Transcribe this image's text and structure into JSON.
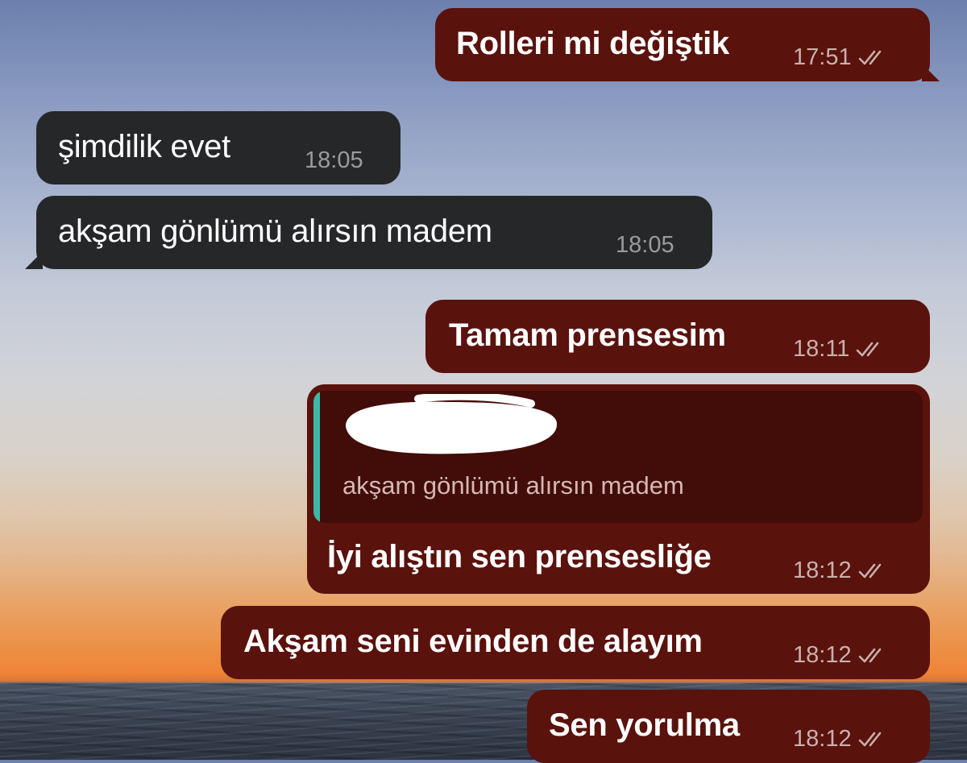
{
  "colors": {
    "outgoing_bubble": "#5a120d",
    "incoming_bubble": "#262729",
    "reply_accent": "#3cb8a8"
  },
  "messages": [
    {
      "direction": "outgoing",
      "text": "Rolleri mi değiştik",
      "time": "17:51",
      "status_icon": "double-check-icon"
    },
    {
      "direction": "incoming",
      "text": "şimdilik evet",
      "time": "18:05"
    },
    {
      "direction": "incoming",
      "text": "akşam gönlümü alırsın madem",
      "time": "18:05"
    },
    {
      "direction": "outgoing",
      "text": "Tamam prensesim",
      "time": "18:11",
      "status_icon": "double-check-icon"
    },
    {
      "direction": "outgoing",
      "text": "İyi alıştın sen prensesliğe",
      "time": "18:12",
      "status_icon": "double-check-icon",
      "reply_to": {
        "author": "",
        "text": "akşam gönlümü alırsın madem"
      }
    },
    {
      "direction": "outgoing",
      "text": "Akşam seni evinden de alayım",
      "time": "18:12",
      "status_icon": "double-check-icon"
    },
    {
      "direction": "outgoing",
      "text": "Sen yorulma",
      "time": "18:12",
      "status_icon": "double-check-icon"
    }
  ]
}
